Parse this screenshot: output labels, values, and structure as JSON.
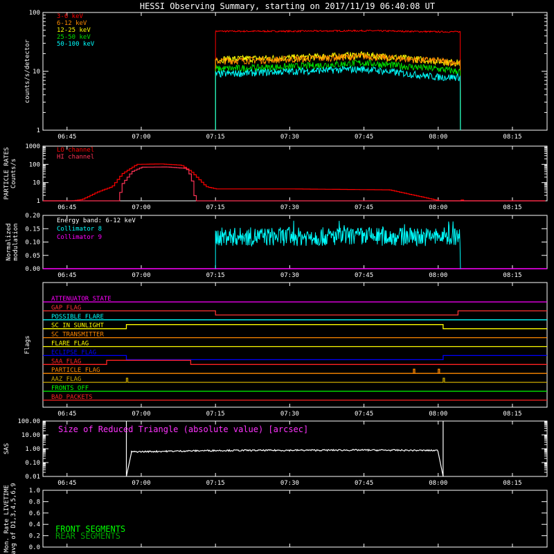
{
  "title": "HESSI Observing Summary, starting on 2017/11/19 06:40:08 UT",
  "x_axis": {
    "tick_labels": [
      "06:45",
      "07:00",
      "07:15",
      "07:30",
      "07:45",
      "08:00",
      "08:15"
    ],
    "range": [
      "06:40:08",
      "08:22:00"
    ]
  },
  "chart_data": [
    {
      "type": "line",
      "panel": "count-rates",
      "ylabel": "counts/s/detector",
      "yscale": "log",
      "ylim": [
        1,
        100
      ],
      "y_tick_labels": [
        "1",
        "10",
        "100"
      ],
      "legend_placement": "top-left",
      "data_window": [
        "07:15:00",
        "08:04:30"
      ],
      "series": [
        {
          "name": "3-6 keV",
          "color": "#ff0000",
          "x": [
            "07:15",
            "07:30",
            "07:45",
            "08:00",
            "08:04"
          ],
          "y": [
            48,
            48,
            49,
            47,
            47
          ]
        },
        {
          "name": "6-12 keV",
          "color": "#ff8c00",
          "x": [
            "07:15",
            "07:30",
            "07:45",
            "08:00",
            "08:04"
          ],
          "y": [
            15,
            16,
            18,
            15,
            14
          ]
        },
        {
          "name": "12-25 keV",
          "color": "#ffff00",
          "x": [
            "07:15",
            "07:30",
            "07:45",
            "08:00",
            "08:04"
          ],
          "y": [
            16,
            17,
            19,
            15,
            14
          ]
        },
        {
          "name": "25-50 keV",
          "color": "#00e000",
          "x": [
            "07:15",
            "07:30",
            "07:45",
            "08:00",
            "08:04"
          ],
          "y": [
            11,
            12,
            14,
            11,
            10
          ]
        },
        {
          "name": "50-100 keV",
          "color": "#00ffff",
          "x": [
            "07:15",
            "07:30",
            "07:45",
            "08:00",
            "08:04"
          ],
          "y": [
            9,
            10,
            11,
            8,
            8
          ]
        }
      ]
    },
    {
      "type": "line",
      "panel": "particle-rates",
      "ylabel": "PARTICLE RATES Counts/s",
      "yscale": "log",
      "ylim": [
        1,
        1000
      ],
      "y_tick_labels": [
        "1",
        "10",
        "100",
        "1000"
      ],
      "legend_placement": "top-left",
      "series": [
        {
          "name": "LO channel",
          "color": "#ff0000",
          "x": [
            "06:40",
            "06:48",
            "06:51",
            "06:54",
            "06:56",
            "06:59",
            "07:04",
            "07:08",
            "07:10",
            "07:13",
            "07:15",
            "07:30",
            "07:50",
            "08:04",
            "08:20"
          ],
          "y": [
            0.6,
            1.2,
            3,
            6,
            30,
            100,
            105,
            90,
            40,
            6,
            4.5,
            4.5,
            4,
            0.6,
            0.6
          ]
        },
        {
          "name": "HI channel",
          "color": "#ff3355",
          "x": [
            "06:40",
            "06:55",
            "06:56",
            "06:58",
            "07:00",
            "07:05",
            "07:09",
            "07:10",
            "07:11",
            "08:20"
          ],
          "y": [
            0.5,
            0.5,
            8,
            40,
            70,
            72,
            60,
            20,
            0.5,
            0.5
          ]
        }
      ]
    },
    {
      "type": "line",
      "panel": "modulation",
      "ylabel": "Normalized modulation",
      "ylim": [
        0,
        0.2
      ],
      "y_tick_labels": [
        "0.00",
        "0.05",
        "0.10",
        "0.15",
        "0.20"
      ],
      "annotation": "Energy band: 6-12 keV",
      "legend_placement": "top-left",
      "data_window": [
        "07:15:00",
        "08:04:30"
      ],
      "series": [
        {
          "name": "Collimator 8",
          "color": "#00ffff",
          "x": [
            "07:15",
            "07:30",
            "07:45",
            "08:00",
            "08:04"
          ],
          "y": [
            0.12,
            0.12,
            0.12,
            0.12,
            0.12
          ]
        },
        {
          "name": "Collimator 9",
          "color": "#ff00ff",
          "x": [
            "06:40",
            "08:22"
          ],
          "y": [
            0,
            0
          ]
        }
      ]
    },
    {
      "type": "line",
      "panel": "flags",
      "ylabel": "Flags",
      "series": [
        {
          "name": "ATTENUATOR_STATE",
          "color": "#ff00ff",
          "transitions": []
        },
        {
          "name": "SAA_FLAG_GAP",
          "label": "GAP_FLAG",
          "color": "#ff3333",
          "transitions": [
            [
              "07:15",
              -1
            ],
            [
              "08:04",
              1
            ]
          ]
        },
        {
          "name": "POSSIBLE_FLARE",
          "color": "#00ffff",
          "transitions": []
        },
        {
          "name": "SC_IN_SUNLIGHT",
          "color": "#ffff00",
          "transitions": [
            [
              "06:57",
              1
            ],
            [
              "08:01",
              -1
            ]
          ]
        },
        {
          "name": "SC_TRANSMITTER",
          "color": "#ff8800",
          "transitions": []
        },
        {
          "name": "FLARE_FLAG",
          "color": "#ffff00",
          "transitions": []
        },
        {
          "name": "ECLIPSE_FLAG",
          "color": "#0000ff",
          "transitions": [
            [
              "06:57",
              -1
            ],
            [
              "08:01",
              1
            ]
          ]
        },
        {
          "name": "SAA_FLAG",
          "color": "#ff2222",
          "transitions": [
            [
              "06:53",
              1
            ],
            [
              "07:10",
              -1
            ]
          ]
        },
        {
          "name": "PARTICLE_FLAG",
          "color": "#ff8800",
          "transitions": [
            [
              "07:55",
              1
            ],
            [
              "08:00",
              1
            ]
          ]
        },
        {
          "name": "AAZ_FLAG",
          "color": "#ccaa00",
          "transitions": [
            [
              "06:57",
              1
            ],
            [
              "08:01",
              1
            ]
          ]
        },
        {
          "name": "FRONTS_OFF",
          "color": "#00ff00",
          "transitions": []
        },
        {
          "name": "BAD_PACKETS",
          "color": "#ff2222",
          "transitions": []
        }
      ]
    },
    {
      "type": "line",
      "panel": "sas",
      "ylabel": "SAS",
      "yscale": "log",
      "ylim": [
        0.01,
        100
      ],
      "y_tick_labels": [
        "0.01",
        "0.10",
        "1.00",
        "10.00",
        "100.00"
      ],
      "annotation": "Size of Reduced Triangle (absolute value) [arcsec]",
      "series": [
        {
          "name": "",
          "color": "#ffffff",
          "x": [
            "06:57",
            "06:58",
            "07:15",
            "07:45",
            "08:00",
            "08:01"
          ],
          "y": [
            100,
            0.6,
            0.75,
            0.8,
            0.75,
            100
          ]
        }
      ]
    },
    {
      "type": "line",
      "panel": "livetime",
      "ylabel": "Mon. Rate LIVETIME avg of D1,3,4,5,6,9",
      "ylim": [
        0,
        1
      ],
      "y_tick_labels": [
        "0.0",
        "0.2",
        "0.4",
        "0.6",
        "0.8",
        "1.0"
      ],
      "legend_placement": "bottom-left",
      "series": [
        {
          "name": "FRONT SEGMENTS",
          "color": "#00ff00",
          "x": [],
          "y": []
        },
        {
          "name": "REAR SEGMENTS",
          "color": "#00a000",
          "x": [],
          "y": []
        }
      ]
    }
  ],
  "flag_labels": [
    "ATTENUATOR_STATE",
    "GAP_FLAG",
    "POSSIBLE_FLARE",
    "SC_IN_SUNLIGHT",
    "SC_TRANSMITTER",
    "FLARE_FLAG",
    "ECLIPSE_FLAG",
    "SAA_FLAG",
    "PARTICLE_FLAG",
    "AAZ_FLAG",
    "FRONTS_OFF",
    "BAD_PACKETS"
  ]
}
